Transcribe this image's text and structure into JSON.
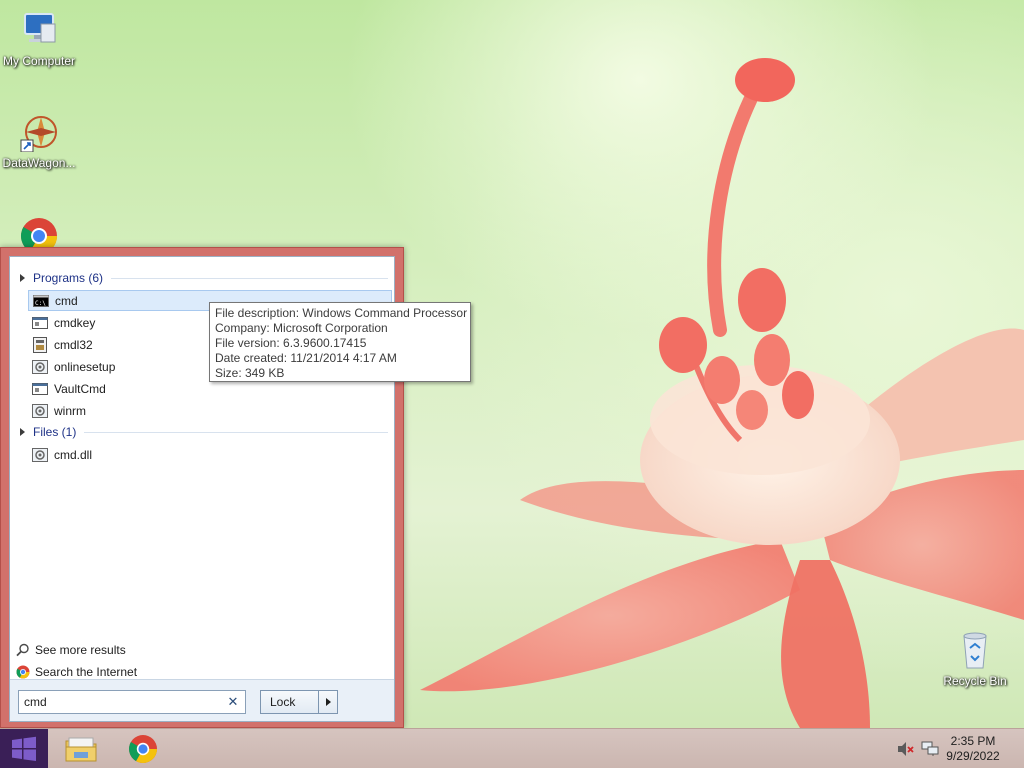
{
  "desktop": {
    "icons": [
      {
        "label": "My Computer",
        "icon": "computer-icon"
      },
      {
        "label": "DataWagon...",
        "icon": "datawagon-icon"
      },
      {
        "label": "",
        "icon": "chrome-icon"
      },
      {
        "label": "Recycle Bin",
        "icon": "recycle-bin-icon"
      }
    ]
  },
  "start_menu": {
    "groups": [
      {
        "label": "Programs (6)"
      },
      {
        "label": "Files (1)"
      }
    ],
    "programs": [
      {
        "label": "cmd",
        "icon": "cmd-icon"
      },
      {
        "label": "cmdkey",
        "icon": "window-app-icon"
      },
      {
        "label": "cmdl32",
        "icon": "cmdl32-icon"
      },
      {
        "label": "onlinesetup",
        "icon": "setup-icon"
      },
      {
        "label": "VaultCmd",
        "icon": "window-app-icon"
      },
      {
        "label": "winrm",
        "icon": "script-icon"
      }
    ],
    "files": [
      {
        "label": "cmd.dll",
        "icon": "dll-file-icon"
      }
    ],
    "see_more": "See more results",
    "search_internet": "Search the Internet",
    "search": {
      "value": "cmd",
      "placeholder": ""
    },
    "lock_label": "Lock"
  },
  "tooltip": {
    "description": "File description: Windows Command Processor",
    "company": "Company: Microsoft Corporation",
    "version": "File version: 6.3.9600.17415",
    "created": "Date created: 11/21/2014 4:17 AM",
    "size": "Size: 349 KB"
  },
  "taskbar": {
    "apps": [
      "file-explorer-icon",
      "chrome-icon"
    ],
    "tray": [
      "volume-muted-icon",
      "network-icon"
    ],
    "clock": {
      "time": "2:35 PM",
      "date": "9/29/2022"
    }
  },
  "colors": {
    "start_frame": "#d2716b",
    "start_button": "#3a1f57",
    "taskbar": "#cbb6b0",
    "group_header": "#1e3287",
    "selection": "#dcebfb"
  }
}
